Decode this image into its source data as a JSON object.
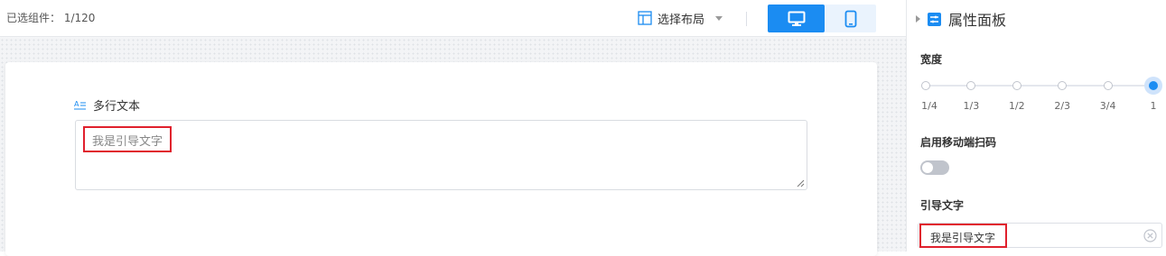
{
  "topbar": {
    "selected_count": "已选组件：  1/120",
    "layout_select_label": "选择布局",
    "device_buttons": [
      {
        "name": "pc",
        "icon": "monitor-icon",
        "active": true
      },
      {
        "name": "mobile",
        "icon": "mobile-icon",
        "active": false
      }
    ]
  },
  "canvas": {
    "field": {
      "label": "多行文本",
      "icon": "multiline-text-icon",
      "placeholder": "我是引导文字"
    }
  },
  "panel": {
    "title": "属性面板",
    "width_section": {
      "label": "宽度",
      "options": [
        "1/4",
        "1/3",
        "1/2",
        "2/3",
        "3/4",
        "1"
      ],
      "selected": "1"
    },
    "scan_section": {
      "label": "启用移动端扫码",
      "enabled": false
    },
    "hint_section": {
      "label": "引导文字",
      "value": "我是引导文字"
    }
  },
  "colors": {
    "accent": "#1b8cf2",
    "highlight_border": "#e0202d"
  }
}
